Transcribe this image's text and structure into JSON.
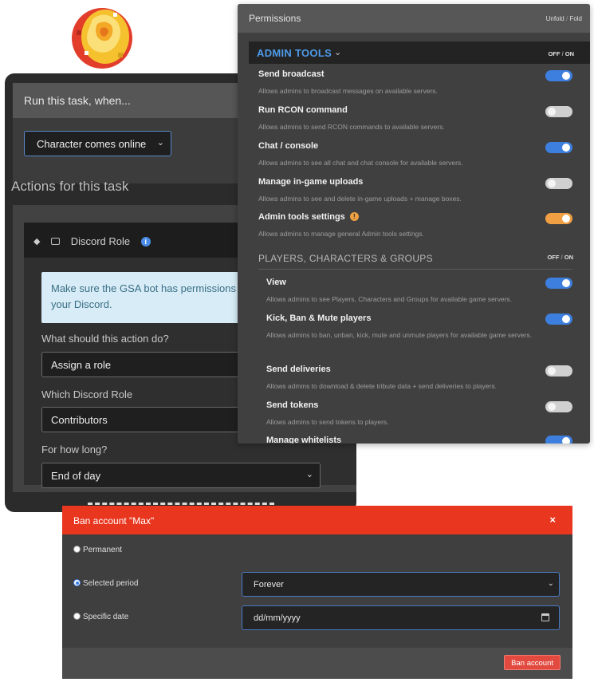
{
  "permissions": {
    "title": "Permissions",
    "unfold_label": "Unfold",
    "fold_label": "Fold",
    "separator": "/",
    "off_label": "OFF",
    "on_label": "ON",
    "admin_tools": {
      "title": "ADMIN TOOLS",
      "items": [
        {
          "title": "Send broadcast",
          "desc": "Allows admins to broadcast messages on available servers.",
          "state": "on"
        },
        {
          "title": "Run RCON command",
          "desc": "Allows admins to send RCON commands to available servers.",
          "state": "off"
        },
        {
          "title": "Chat / console",
          "desc": "Allows admins to see all chat and chat console for available servers.",
          "state": "on"
        },
        {
          "title": "Manage in-game uploads",
          "desc": "Allows admins to see and delete in-game uploads + manage boxes.",
          "state": "off"
        },
        {
          "title": "Admin tools settings",
          "desc": "Allows admins to manage general Admin tools settings.",
          "state": "warn"
        }
      ]
    },
    "players_section": {
      "title": "PLAYERS, CHARACTERS & GROUPS",
      "items": [
        {
          "title": "View",
          "desc": "Allows admins to see Players, Characters and Groups for available game servers.",
          "state": "on"
        },
        {
          "title": "Kick, Ban & Mute players",
          "desc": "Allows admins to ban, unban, kick, mute and unmute players for available game servers.",
          "state": "on"
        },
        {
          "title": "Send deliveries",
          "desc": "Allows admins to download & delete tribute data + send deliveries to players.",
          "state": "off"
        },
        {
          "title": "Send tokens",
          "desc": "Allows admins to send tokens to players.",
          "state": "off"
        },
        {
          "title": "Manage whitelists",
          "desc": "",
          "state": "on"
        }
      ]
    }
  },
  "task": {
    "run_header": "Run this task, when...",
    "trigger_value": "Character comes online",
    "actions_title": "Actions for this task",
    "action_name": "Discord Role",
    "alert_line1": "Make sure the GSA bot has permissions to a",
    "alert_line2": "your Discord.",
    "q1_label": "What should this action do?",
    "q1_value": "Assign a role",
    "q2_label": "Which Discord Role",
    "q2_value": "Contributors",
    "q3_label": "For how long?",
    "q3_value": "End of day"
  },
  "ban": {
    "title": "Ban account \"Max\"",
    "close": "×",
    "option_permanent": "Permanent",
    "option_period": "Selected period",
    "option_date": "Specific date",
    "period_value": "Forever",
    "date_placeholder": "dd/mm/yyyy",
    "submit_label": "Ban account"
  },
  "icons": {
    "logo": "rose-logo-icon",
    "chevron": "chevron-down-icon",
    "info": "info-icon",
    "warning": "warning-icon",
    "calendar": "calendar-icon"
  },
  "colors": {
    "accent_blue": "#3d7fdf",
    "warning_orange": "#f0a042",
    "danger_red": "#e9361f"
  }
}
